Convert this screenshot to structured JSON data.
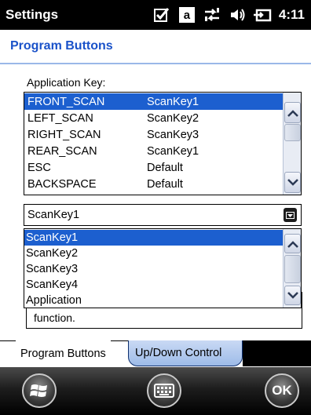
{
  "status_bar": {
    "title": "Settings",
    "time": "4:11",
    "icons": [
      "checkbox-icon",
      "input-mode-icon",
      "connectivity-icon",
      "volume-icon",
      "battery-icon"
    ],
    "input_mode_letter": "a"
  },
  "page": {
    "title": "Program Buttons",
    "application_key_label": "Application Key:"
  },
  "application_keys": [
    {
      "key": "FRONT_SCAN",
      "value": "ScanKey1",
      "selected": true
    },
    {
      "key": "LEFT_SCAN",
      "value": "ScanKey2",
      "selected": false
    },
    {
      "key": "RIGHT_SCAN",
      "value": "ScanKey3",
      "selected": false
    },
    {
      "key": "REAR_SCAN",
      "value": "ScanKey1",
      "selected": false
    },
    {
      "key": "ESC",
      "value": "Default",
      "selected": false
    },
    {
      "key": "BACKSPACE",
      "value": "Default",
      "selected": false
    }
  ],
  "combo": {
    "selected": "ScanKey1",
    "options": [
      "ScanKey1",
      "ScanKey2",
      "ScanKey3",
      "ScanKey4",
      "Application"
    ]
  },
  "description": {
    "text": "function."
  },
  "tabs": [
    {
      "label": "Program Buttons",
      "active": true
    },
    {
      "label": "Up/Down Control",
      "active": false
    }
  ],
  "bottom_bar": {
    "ok_label": "OK"
  },
  "colors": {
    "accent": "#1a52c9",
    "selection": "#1c5fcf"
  }
}
